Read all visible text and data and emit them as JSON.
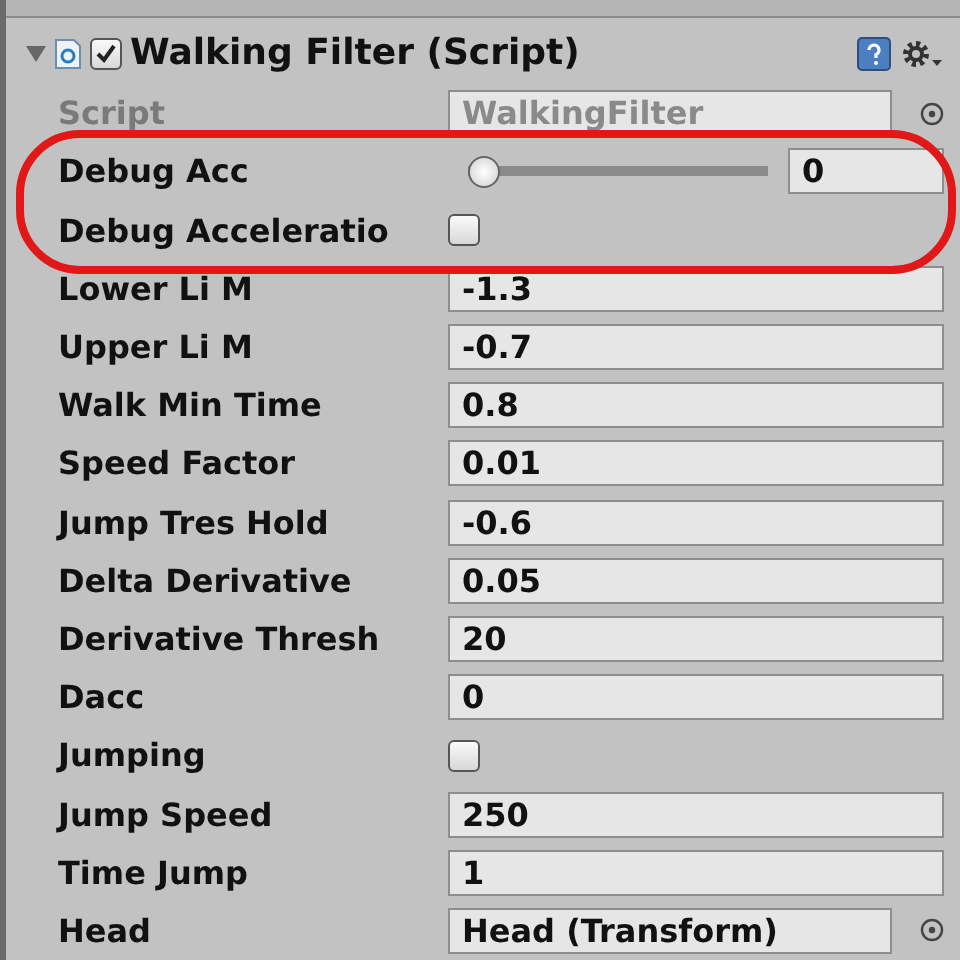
{
  "component": {
    "title": "Walking Filter (Script)",
    "enabled": true,
    "expanded": true
  },
  "fields": [
    {
      "kind": "object",
      "label": "Script",
      "value": "WalkingFilter",
      "disabled": true
    },
    {
      "kind": "slider",
      "label": "Debug Acc",
      "value": "0",
      "level": 0
    },
    {
      "kind": "checkbox",
      "label": "Debug Acceleratio",
      "checked": false
    },
    {
      "kind": "text",
      "label": "Lower Li M",
      "value": "-1.3"
    },
    {
      "kind": "text",
      "label": "Upper Li M",
      "value": "-0.7"
    },
    {
      "kind": "text",
      "label": "Walk Min Time",
      "value": "0.8"
    },
    {
      "kind": "text",
      "label": "Speed Factor",
      "value": "0.01"
    },
    {
      "kind": "text",
      "label": "Jump Tres Hold",
      "value": "-0.6"
    },
    {
      "kind": "text",
      "label": "Delta Derivative",
      "value": "0.05"
    },
    {
      "kind": "text",
      "label": "Derivative Thresh",
      "value": "20"
    },
    {
      "kind": "text",
      "label": "Dacc",
      "value": "0"
    },
    {
      "kind": "checkbox",
      "label": "Jumping",
      "checked": false
    },
    {
      "kind": "text",
      "label": "Jump Speed",
      "value": "250"
    },
    {
      "kind": "text",
      "label": "Time Jump",
      "value": "1"
    },
    {
      "kind": "object",
      "label": "Head",
      "value": "Head (Transform)",
      "disabled": false
    }
  ]
}
